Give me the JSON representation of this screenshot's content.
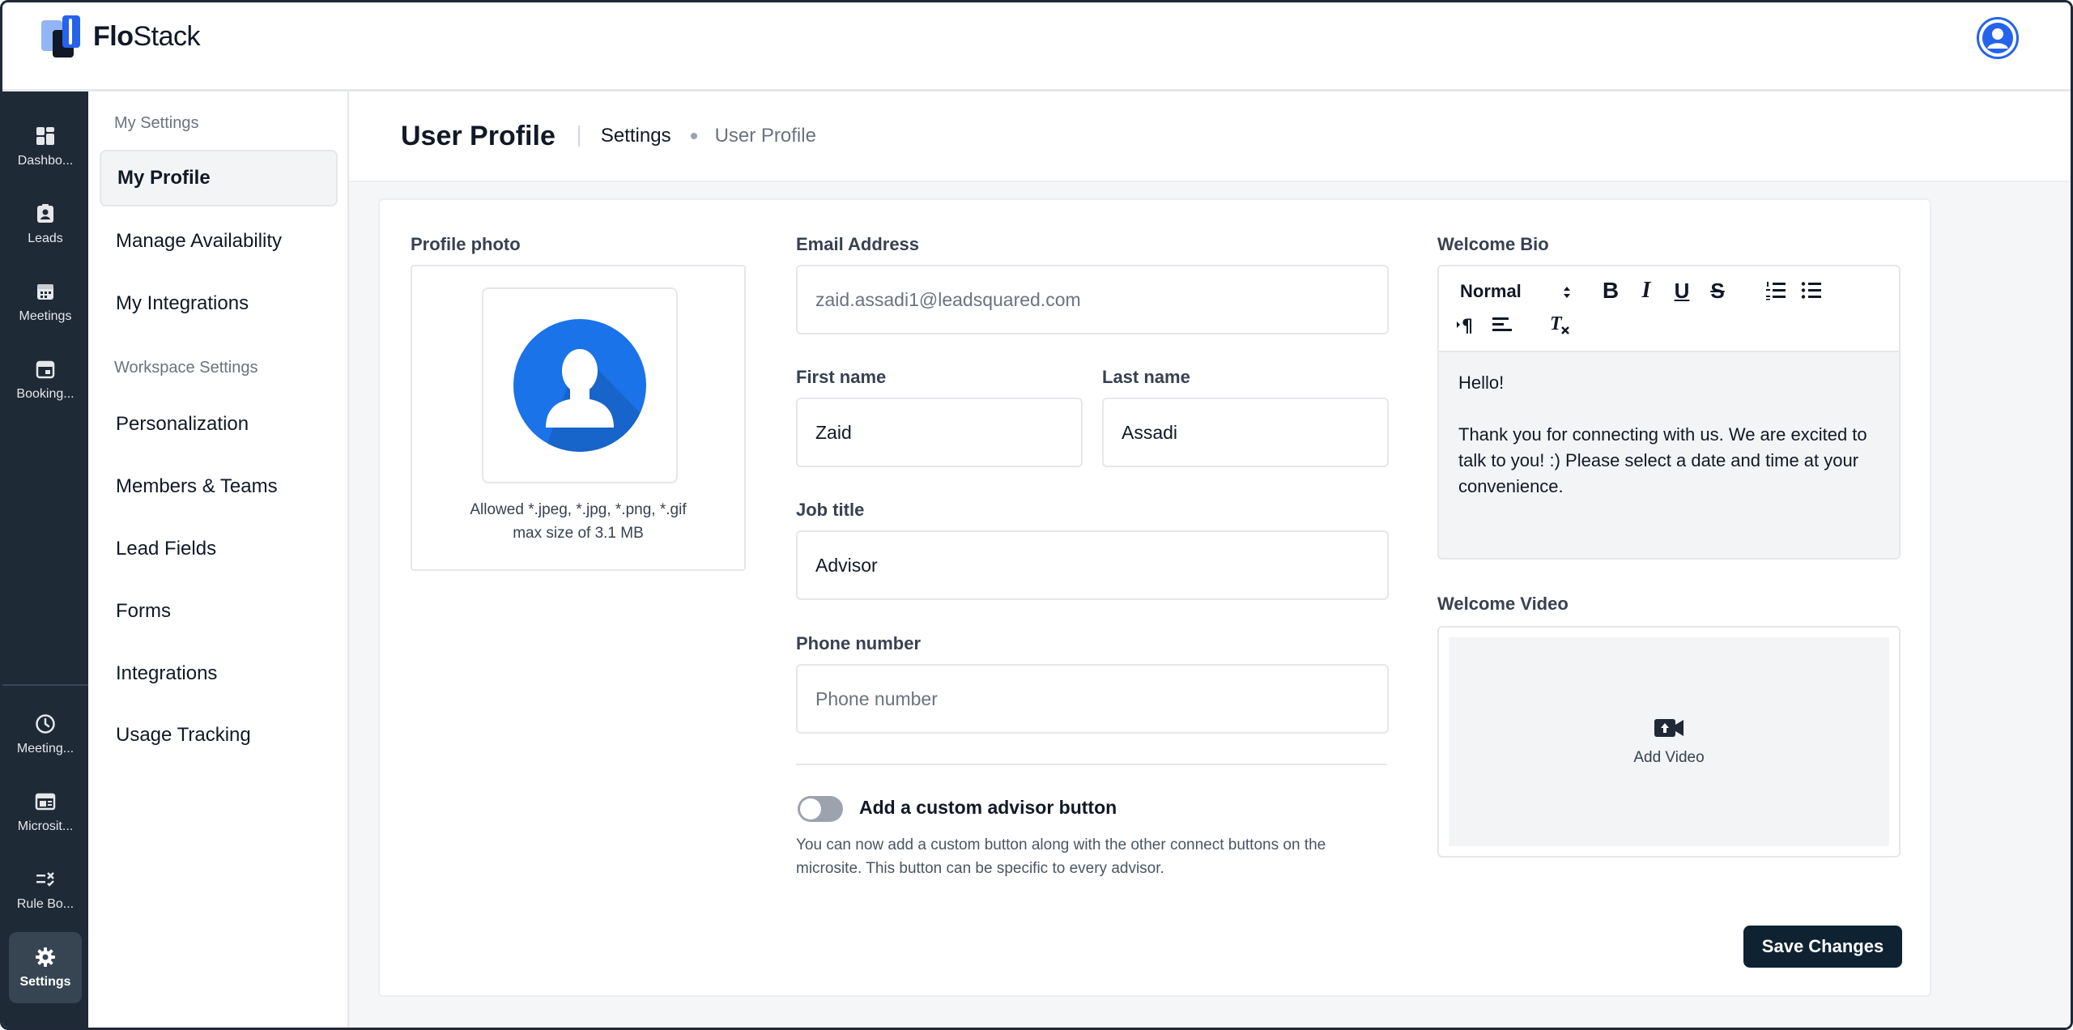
{
  "app": {
    "logo_bold": "Flo",
    "logo_rest": "Stack"
  },
  "leftnav": {
    "items": [
      {
        "label": "Dashbo...",
        "icon": "dashboard-icon"
      },
      {
        "label": "Leads",
        "icon": "contact-book-icon"
      },
      {
        "label": "Meetings",
        "icon": "calendar-icon"
      },
      {
        "label": "Booking...",
        "icon": "calendar-event-icon"
      },
      {
        "label": "Meeting...",
        "icon": "clock-icon"
      },
      {
        "label": "Microsit...",
        "icon": "browser-window-icon"
      },
      {
        "label": "Rule Bo...",
        "icon": "rules-icon"
      },
      {
        "label": "Settings",
        "icon": "gear-icon"
      }
    ],
    "active_index": 7
  },
  "sidebar": {
    "section_my": "My Settings",
    "section_workspace": "Workspace Settings",
    "my_items": [
      "My Profile",
      "Manage Availability",
      "My Integrations"
    ],
    "workspace_items": [
      "Personalization",
      "Members & Teams",
      "Lead Fields",
      "Forms",
      "Integrations",
      "Usage Tracking"
    ]
  },
  "header": {
    "title": "User Profile",
    "breadcrumb": [
      "Settings",
      "User Profile"
    ]
  },
  "profile": {
    "photo_label": "Profile photo",
    "photo_help_1": "Allowed *.jpeg, *.jpg, *.png, *.gif",
    "photo_help_2": "max size of 3.1 MB",
    "email_label": "Email Address",
    "email_value": "zaid.assadi1@leadsquared.com",
    "first_name_label": "First name",
    "first_name_value": "Zaid",
    "last_name_label": "Last name",
    "last_name_value": "Assadi",
    "job_title_label": "Job title",
    "job_title_value": "Advisor",
    "phone_label": "Phone number",
    "phone_placeholder": "Phone number",
    "toggle_label": "Add a custom advisor button",
    "toggle_on": false,
    "toggle_help": "You can now add a custom button along with the other connect buttons on the microsite. This button can be specific to every advisor."
  },
  "bio": {
    "label": "Welcome Bio",
    "format_select": "Normal",
    "line1": "Hello!",
    "line2": "Thank you for connecting with us. We are excited to talk to you! :) Please select a date and time at your convenience."
  },
  "video": {
    "label": "Welcome Video",
    "add_label": "Add Video"
  },
  "actions": {
    "save_label": "Save Changes"
  },
  "colors": {
    "accent": "#2563eb",
    "nav_bg": "#1e2a36",
    "save_bg": "#0f2231"
  }
}
